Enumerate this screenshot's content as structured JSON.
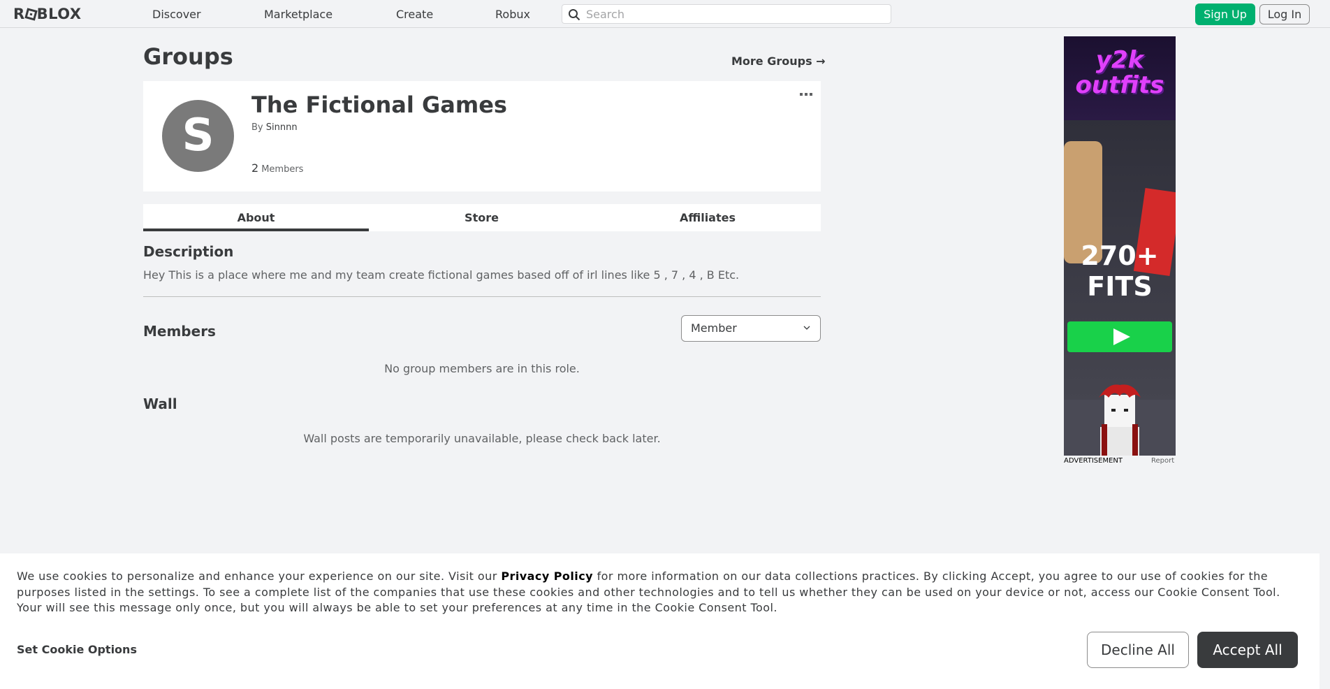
{
  "header": {
    "logo_text": "ROBLOX",
    "nav": [
      "Discover",
      "Marketplace",
      "Create",
      "Robux"
    ],
    "search_placeholder": "Search",
    "signup_label": "Sign Up",
    "login_label": "Log In"
  },
  "page": {
    "title": "Groups",
    "more_groups_label": "More Groups →"
  },
  "group": {
    "avatar_letter": "S",
    "name": "The Fictional Games",
    "by_prefix": "By",
    "owner": "Sinnnn",
    "member_count": "2",
    "members_label": "Members"
  },
  "tabs": [
    "About",
    "Store",
    "Affiliates"
  ],
  "active_tab": "About",
  "about": {
    "description_heading": "Description",
    "description_text": "Hey This is a place where me and my team create fictional games based off of irl lines like 5 , 7 , 4 , B Etc.",
    "members_heading": "Members",
    "role_selected": "Member",
    "members_empty": "No group members are in this role.",
    "wall_heading": "Wall",
    "wall_empty": "Wall posts are temporarily unavailable, please check back later."
  },
  "ad": {
    "logo_text": "y2k outfits",
    "headline": "270+ FITS",
    "label": "ADVERTISEMENT",
    "report_label": "Report"
  },
  "cookie_banner": {
    "text_1": "We use cookies to personalize and enhance your experience on our site. Visit our ",
    "privacy_link": "Privacy Policy",
    "text_2": " for more information on our data collections practices. By clicking Accept, you agree to our use of cookies for the purposes listed in the settings. To see a complete list of the companies that use these cookies and other technologies and to tell us whether they can be used on your device or not, access our ",
    "consent_link_1": "Cookie Consent Tool",
    "text_3": ". Your will see this message only once, but you will always be able to set your preferences at any time in the ",
    "consent_link_2": "Cookie Consent Tool",
    "text_4": ".",
    "set_options_label": "Set Cookie Options",
    "decline_label": "Decline All",
    "accept_label": "Accept All"
  },
  "colors": {
    "brand_green": "#00b06f",
    "text_primary": "#393b3d",
    "background": "#f2f3f5"
  }
}
